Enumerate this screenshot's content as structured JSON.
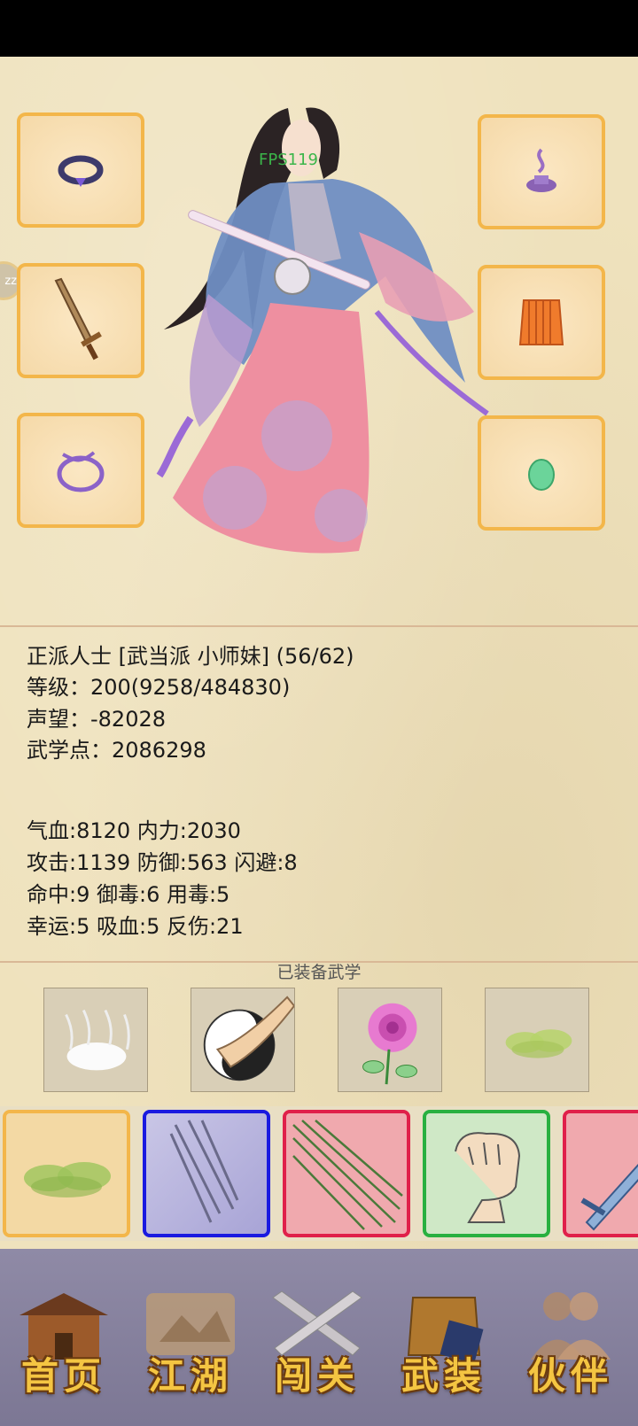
{
  "overlay": {
    "fps": "FPS119",
    "side_handle": "zz"
  },
  "character": {
    "title_line": "正派人士 [武当派 小师妹] (56/62)",
    "level_line": "等级：200(9258/484830)",
    "fame_line": "声望：-82028",
    "points_line": "武学点：2086298"
  },
  "stats": {
    "line1": "气血:8120  内力:2030",
    "line2": "攻击:1139  防御:563  闪避:8",
    "line3": "命中:9  御毒:6  用毒:5",
    "line4": "幸运:5  吸血:5  反伤:21"
  },
  "skills": {
    "title": "已装备武学"
  },
  "equipment": {
    "left": [
      "ring-icon",
      "sword-icon",
      "bracelet-icon"
    ],
    "right": [
      "incense-icon",
      "armor-icon",
      "jade-icon"
    ]
  },
  "cards": [
    {
      "icon": "poison-cloud-icon",
      "border": "#f3b64a"
    },
    {
      "icon": "blade-slash-icon",
      "border": "#1a1ae0"
    },
    {
      "icon": "needles-icon",
      "border": "#e0204a"
    },
    {
      "icon": "fist-icon",
      "border": "#28b040"
    },
    {
      "icon": "sword-icon",
      "border": "#e0204a"
    }
  ],
  "nav": {
    "home": "首页",
    "jianghu": "江湖",
    "challenge": "闯关",
    "equip": "武装",
    "partner": "伙伴"
  }
}
